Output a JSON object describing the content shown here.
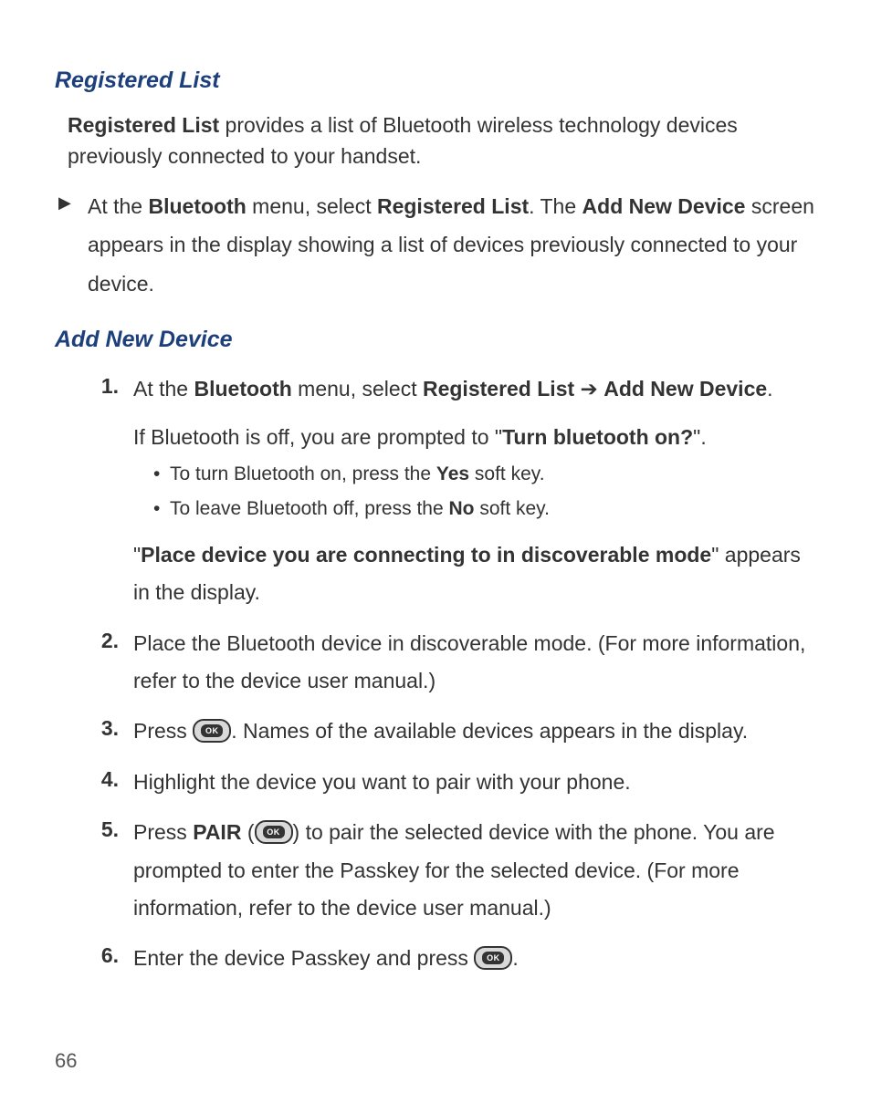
{
  "page_number": "66",
  "section1": {
    "heading": "Registered List",
    "intro_bold": "Registered List",
    "intro_rest": " provides a list of Bluetooth wireless technology devices previously connected to your handset.",
    "bullet_parts": {
      "p1": "At the ",
      "b1": "Bluetooth",
      "p2": " menu, select ",
      "b2": "Registered List",
      "p3": ". The ",
      "b3": "Add New Device",
      "p4": " screen appears in the display showing a list of devices previously connected to your device."
    }
  },
  "section2": {
    "heading": "Add New Device",
    "steps": {
      "s1": {
        "num": "1.",
        "p1": "At the ",
        "b1": "Bluetooth",
        "p2": " menu, select ",
        "b2": "Registered List",
        "arrow": " ➔ ",
        "b3": "Add New Device",
        "p3": ".",
        "line2_a": "If Bluetooth is off, you are prompted to \"",
        "line2_b": "Turn bluetooth on?",
        "line2_c": "\".",
        "sub_a_pre": "To turn Bluetooth on, press the ",
        "sub_a_bold": "Yes",
        "sub_a_post": " soft key.",
        "sub_b_pre": "To leave Bluetooth off, press the ",
        "sub_b_bold": "No",
        "sub_b_post": " soft key.",
        "line3_a": "\"",
        "line3_b": "Place device you are connecting to in discoverable mode",
        "line3_c": "\" appears in the display."
      },
      "s2": {
        "num": "2.",
        "text": "Place the Bluetooth device in discoverable mode. (For more information, refer to the device user manual.)"
      },
      "s3": {
        "num": "3.",
        "pre": "Press ",
        "post": ". Names of the available devices appears in the display."
      },
      "s4": {
        "num": "4.",
        "text": "Highlight the device you want to pair with your phone."
      },
      "s5": {
        "num": "5.",
        "pre": "Press ",
        "bold": "PAIR",
        "paren_open": " (",
        "paren_close": ") ",
        "post": "to pair the selected device with the phone. You are prompted to enter the Passkey for the selected device. (For more information, refer to the device user manual.)"
      },
      "s6": {
        "num": "6.",
        "pre": "Enter the device Passkey and press ",
        "post": "."
      }
    }
  },
  "ok_label": "OK"
}
